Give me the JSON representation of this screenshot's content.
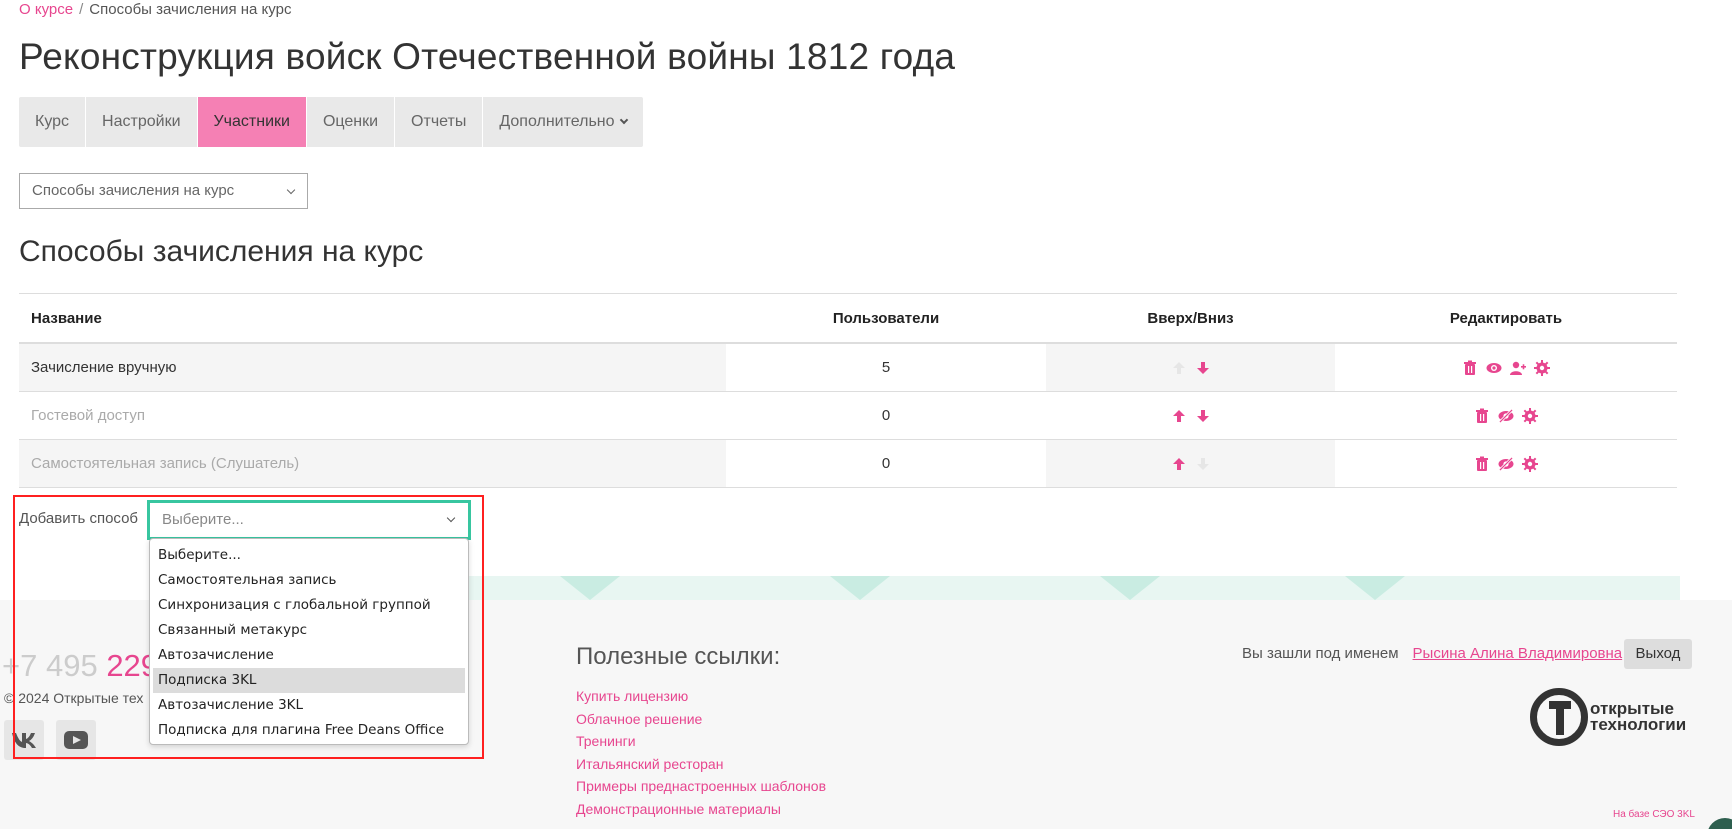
{
  "breadcrumb": {
    "link": "О курсе",
    "separator": "/",
    "current": "Способы зачисления на курс"
  },
  "page_title": "Реконструкция войск Отечественной войны 1812 года",
  "tabs": [
    {
      "label": "Курс"
    },
    {
      "label": "Настройки"
    },
    {
      "label": "Участники",
      "active": true
    },
    {
      "label": "Оценки"
    },
    {
      "label": "Отчеты"
    },
    {
      "label": "Дополнительно"
    }
  ],
  "nav_select": {
    "value": "Способы зачисления на курс"
  },
  "section_title": "Способы зачисления на курс",
  "table": {
    "headers": [
      "Название",
      "Пользователи",
      "Вверх/Вниз",
      "Редактировать"
    ],
    "rows": [
      {
        "name": "Зачисление вручную",
        "users": "5",
        "updown": [
          "arrow-down-icon"
        ],
        "actions": [
          "trash-icon",
          "eye-icon",
          "user-plus-icon",
          "gear-icon"
        ]
      },
      {
        "name": "Гостевой доступ",
        "users": "0",
        "updown": [
          "arrow-up-icon",
          "arrow-down-icon"
        ],
        "actions": [
          "trash-icon",
          "eye-slash-icon",
          "gear-icon"
        ]
      },
      {
        "name": "Самостоятельная запись (Слушатель)",
        "users": "0",
        "updown": [
          "arrow-up-icon"
        ],
        "actions": [
          "trash-icon",
          "eye-slash-icon",
          "gear-icon"
        ]
      }
    ]
  },
  "add_method": {
    "label": "Добавить способ",
    "placeholder": "Выберите...",
    "options": [
      "Выберите...",
      "Самостоятельная запись",
      "Синхронизация с глобальной группой",
      "Связанный метакурс",
      "Автозачисление",
      "Подписка 3KL",
      "Автозачисление 3KL",
      "Подписка для плагина Free Deans Office"
    ],
    "highlighted": "Подписка 3KL"
  },
  "footer": {
    "phone_prefix": "+7 495",
    "phone_pink": "229",
    "copyright": "© 2024  Открытые тех",
    "social": [
      "vk-icon",
      "youtube-icon"
    ],
    "links_title": "Полезные ссылки:",
    "links": [
      "Купить лицензию",
      "Облачное решение",
      "Тренинги",
      "Итальянский ресторан",
      "Примеры преднастроенных шаблонов",
      "Демонстрационные материалы"
    ],
    "login_text": "Вы зашли под именем",
    "user_name": "Рысина Алина Владимировна",
    "logout": "Выход",
    "logo_line1": "открытые",
    "logo_line2": "технологии",
    "powered": "На базе СЭО 3KL"
  },
  "colors": {
    "accent": "#e7468f",
    "active_tab": "#f580b4",
    "focus": "#38c6a0",
    "highlight_box": "#ff2020"
  }
}
